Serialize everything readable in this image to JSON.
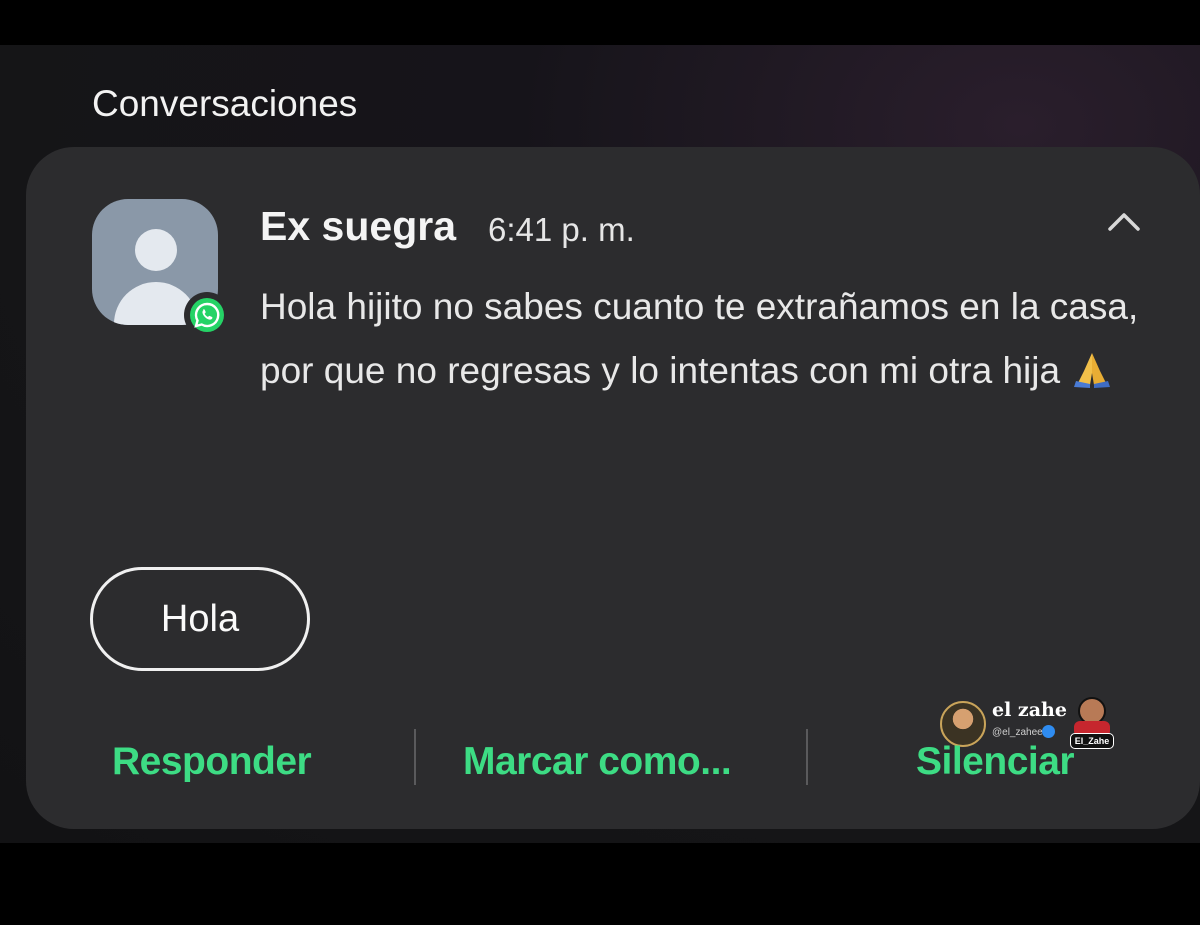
{
  "section": {
    "title": "Conversaciones"
  },
  "notification": {
    "sender": "Ex suegra",
    "time": "6:41 p. m.",
    "message": "Hola hijito no sabes cuanto te extrañamos en la casa, por que no regresas y lo intentas con mi otra hija",
    "app_icon": "whatsapp-icon",
    "avatar_icon": "person-icon",
    "collapse_icon": "chevron-up-icon",
    "emoji_icon": "folded-hands-emoji",
    "quick_reply": "Hola",
    "actions": {
      "reply": "Responder",
      "mark_as": "Marcar como...",
      "mute": "Silenciar"
    }
  },
  "watermark": {
    "name": "el zahe",
    "handle": "@el_zahee",
    "tag": "El_Zahe"
  },
  "colors": {
    "accent": "#3ddc84",
    "card_bg": "#2c2c2e",
    "whatsapp_green": "#25d366"
  }
}
